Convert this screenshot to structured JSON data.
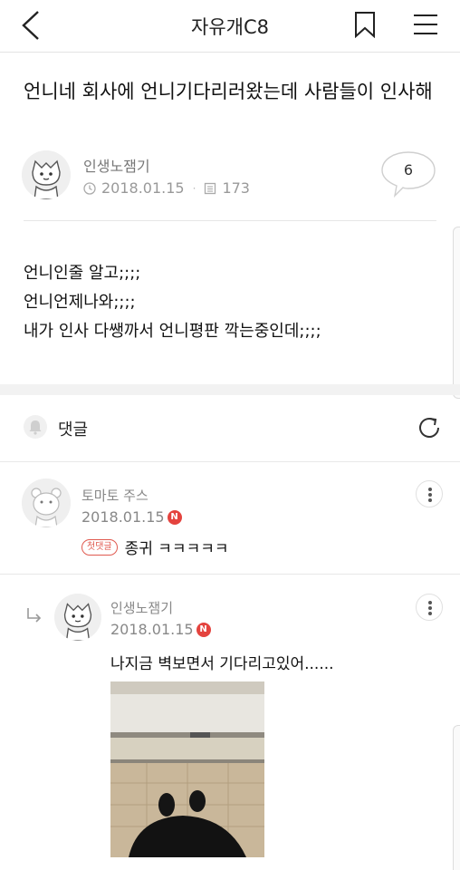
{
  "header": {
    "title": "자유개C8",
    "back_icon": "chevron-left-icon",
    "bookmark_icon": "bookmark-icon",
    "menu_icon": "hamburger-icon"
  },
  "post": {
    "title": "언니네 회사에 언니기다리러왔는데 사람들이 인사해",
    "author": "인생노잼기",
    "date": "2018.01.15",
    "views": "173",
    "comment_count": "6",
    "body": [
      "언니인줄 알고;;;;",
      "언니언제나와;;;;",
      "내가 인사 다쌩까서 언니평판 깍는중인데;;;;"
    ]
  },
  "comments_section": {
    "label": "댓글",
    "refresh_icon": "refresh-icon",
    "bell_icon": "bell-icon"
  },
  "comments": [
    {
      "author": "토마토 주스",
      "date": "2018.01.15",
      "new_badge": "N",
      "first_badge": "첫댓글",
      "text": "종귀 ㅋㅋㅋㅋㅋ"
    },
    {
      "author": "인생노잼기",
      "date": "2018.01.15",
      "new_badge": "N",
      "text": "나지금 벽보면서 기다리고있어......",
      "reply_icon": "reply-arrow-icon"
    }
  ],
  "colors": {
    "badge_red": "#e4433e",
    "text_gray": "#888888",
    "divider": "#e8e8e8"
  }
}
